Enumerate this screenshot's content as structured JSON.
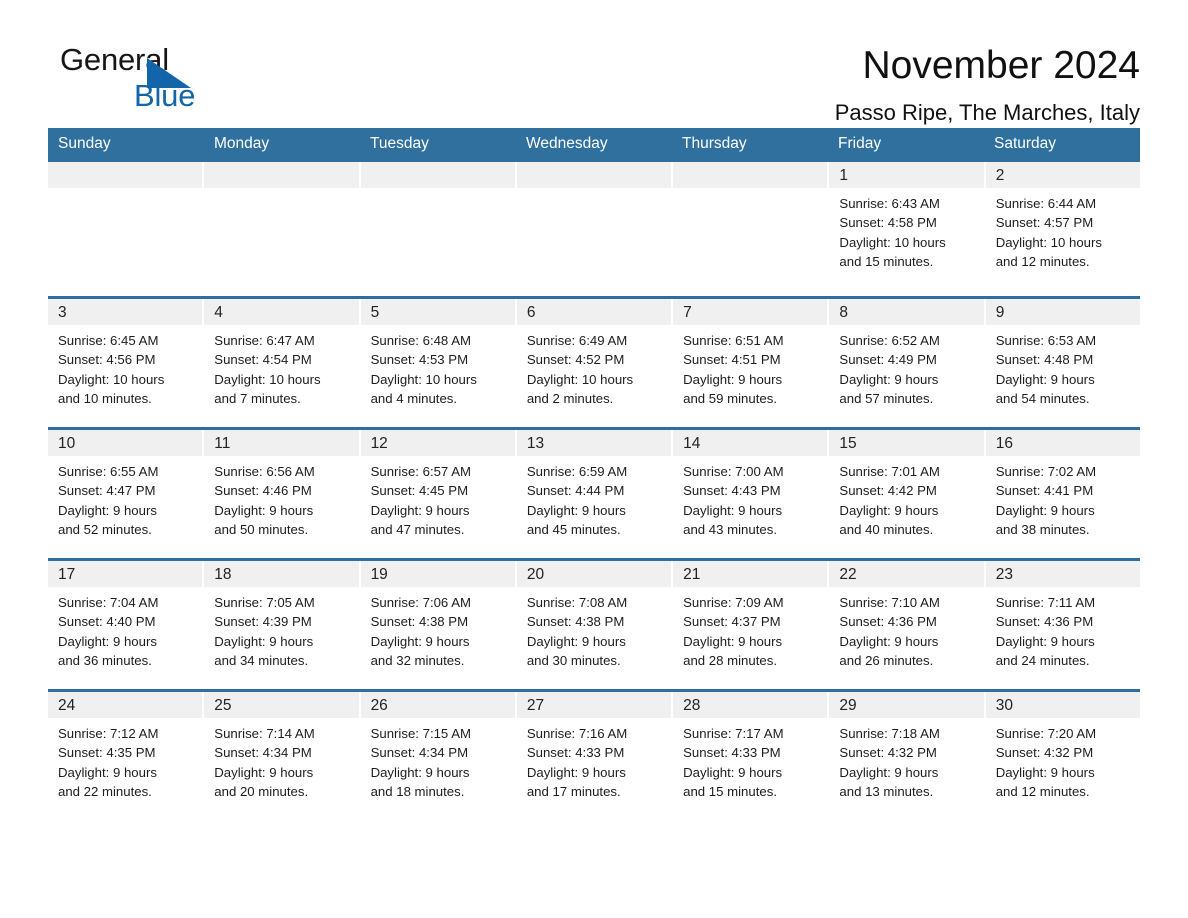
{
  "logo": {
    "text_primary": "General",
    "text_secondary": "Blue",
    "triangle_color": "#1165a8"
  },
  "header": {
    "title": "November 2024",
    "location": "Passo Ripe, The Marches, Italy"
  },
  "theme": {
    "header_blue": "#30709e",
    "row_divider_blue": "#2f6fa0",
    "day_number_band": "#f0f0f0",
    "text": "#1d1d1d"
  },
  "weekdays": [
    "Sunday",
    "Monday",
    "Tuesday",
    "Wednesday",
    "Thursday",
    "Friday",
    "Saturday"
  ],
  "weeks": [
    [
      {
        "day": "",
        "info": ""
      },
      {
        "day": "",
        "info": ""
      },
      {
        "day": "",
        "info": ""
      },
      {
        "day": "",
        "info": ""
      },
      {
        "day": "",
        "info": ""
      },
      {
        "day": "1",
        "info": "Sunrise: 6:43 AM\nSunset: 4:58 PM\nDaylight: 10 hours\nand 15 minutes."
      },
      {
        "day": "2",
        "info": "Sunrise: 6:44 AM\nSunset: 4:57 PM\nDaylight: 10 hours\nand 12 minutes."
      }
    ],
    [
      {
        "day": "3",
        "info": "Sunrise: 6:45 AM\nSunset: 4:56 PM\nDaylight: 10 hours\nand 10 minutes."
      },
      {
        "day": "4",
        "info": "Sunrise: 6:47 AM\nSunset: 4:54 PM\nDaylight: 10 hours\nand 7 minutes."
      },
      {
        "day": "5",
        "info": "Sunrise: 6:48 AM\nSunset: 4:53 PM\nDaylight: 10 hours\nand 4 minutes."
      },
      {
        "day": "6",
        "info": "Sunrise: 6:49 AM\nSunset: 4:52 PM\nDaylight: 10 hours\nand 2 minutes."
      },
      {
        "day": "7",
        "info": "Sunrise: 6:51 AM\nSunset: 4:51 PM\nDaylight: 9 hours\nand 59 minutes."
      },
      {
        "day": "8",
        "info": "Sunrise: 6:52 AM\nSunset: 4:49 PM\nDaylight: 9 hours\nand 57 minutes."
      },
      {
        "day": "9",
        "info": "Sunrise: 6:53 AM\nSunset: 4:48 PM\nDaylight: 9 hours\nand 54 minutes."
      }
    ],
    [
      {
        "day": "10",
        "info": "Sunrise: 6:55 AM\nSunset: 4:47 PM\nDaylight: 9 hours\nand 52 minutes."
      },
      {
        "day": "11",
        "info": "Sunrise: 6:56 AM\nSunset: 4:46 PM\nDaylight: 9 hours\nand 50 minutes."
      },
      {
        "day": "12",
        "info": "Sunrise: 6:57 AM\nSunset: 4:45 PM\nDaylight: 9 hours\nand 47 minutes."
      },
      {
        "day": "13",
        "info": "Sunrise: 6:59 AM\nSunset: 4:44 PM\nDaylight: 9 hours\nand 45 minutes."
      },
      {
        "day": "14",
        "info": "Sunrise: 7:00 AM\nSunset: 4:43 PM\nDaylight: 9 hours\nand 43 minutes."
      },
      {
        "day": "15",
        "info": "Sunrise: 7:01 AM\nSunset: 4:42 PM\nDaylight: 9 hours\nand 40 minutes."
      },
      {
        "day": "16",
        "info": "Sunrise: 7:02 AM\nSunset: 4:41 PM\nDaylight: 9 hours\nand 38 minutes."
      }
    ],
    [
      {
        "day": "17",
        "info": "Sunrise: 7:04 AM\nSunset: 4:40 PM\nDaylight: 9 hours\nand 36 minutes."
      },
      {
        "day": "18",
        "info": "Sunrise: 7:05 AM\nSunset: 4:39 PM\nDaylight: 9 hours\nand 34 minutes."
      },
      {
        "day": "19",
        "info": "Sunrise: 7:06 AM\nSunset: 4:38 PM\nDaylight: 9 hours\nand 32 minutes."
      },
      {
        "day": "20",
        "info": "Sunrise: 7:08 AM\nSunset: 4:38 PM\nDaylight: 9 hours\nand 30 minutes."
      },
      {
        "day": "21",
        "info": "Sunrise: 7:09 AM\nSunset: 4:37 PM\nDaylight: 9 hours\nand 28 minutes."
      },
      {
        "day": "22",
        "info": "Sunrise: 7:10 AM\nSunset: 4:36 PM\nDaylight: 9 hours\nand 26 minutes."
      },
      {
        "day": "23",
        "info": "Sunrise: 7:11 AM\nSunset: 4:36 PM\nDaylight: 9 hours\nand 24 minutes."
      }
    ],
    [
      {
        "day": "24",
        "info": "Sunrise: 7:12 AM\nSunset: 4:35 PM\nDaylight: 9 hours\nand 22 minutes."
      },
      {
        "day": "25",
        "info": "Sunrise: 7:14 AM\nSunset: 4:34 PM\nDaylight: 9 hours\nand 20 minutes."
      },
      {
        "day": "26",
        "info": "Sunrise: 7:15 AM\nSunset: 4:34 PM\nDaylight: 9 hours\nand 18 minutes."
      },
      {
        "day": "27",
        "info": "Sunrise: 7:16 AM\nSunset: 4:33 PM\nDaylight: 9 hours\nand 17 minutes."
      },
      {
        "day": "28",
        "info": "Sunrise: 7:17 AM\nSunset: 4:33 PM\nDaylight: 9 hours\nand 15 minutes."
      },
      {
        "day": "29",
        "info": "Sunrise: 7:18 AM\nSunset: 4:32 PM\nDaylight: 9 hours\nand 13 minutes."
      },
      {
        "day": "30",
        "info": "Sunrise: 7:20 AM\nSunset: 4:32 PM\nDaylight: 9 hours\nand 12 minutes."
      }
    ]
  ]
}
